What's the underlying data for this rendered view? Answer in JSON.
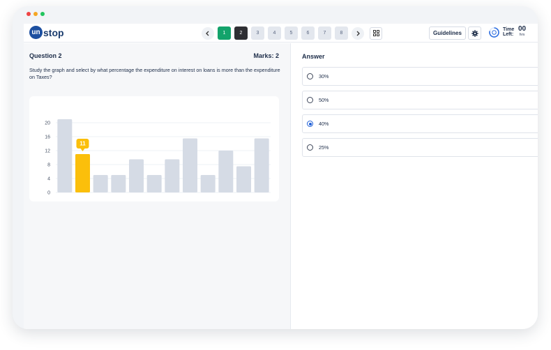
{
  "window": {
    "dot_colors": [
      "#ef4444",
      "#f5a623",
      "#22c55e"
    ]
  },
  "brand": {
    "badge": "un",
    "rest": "stop"
  },
  "nav": {
    "prev_icon": "chevron-left-icon",
    "next_icon": "chevron-right-icon",
    "questions": [
      {
        "label": "1",
        "state": "current"
      },
      {
        "label": "2",
        "state": "visited"
      },
      {
        "label": "3",
        "state": "unvisited"
      },
      {
        "label": "4",
        "state": "unvisited"
      },
      {
        "label": "5",
        "state": "unvisited"
      },
      {
        "label": "6",
        "state": "unvisited"
      },
      {
        "label": "7",
        "state": "unvisited"
      },
      {
        "label": "8",
        "state": "unvisited"
      }
    ],
    "grid_icon": "grid-icon"
  },
  "header": {
    "guidelines_label": "Guidelines",
    "settings_icon": "gear-icon",
    "time_label_1": "Time",
    "time_label_2": "Left:",
    "time_value": "00",
    "time_unit": "hrs"
  },
  "question": {
    "title": "Question 2",
    "marks": "Marks: 2",
    "text": "Study the graph and select by what percentage the expenditure on interest on loans is more than the expenditure on Taxes?"
  },
  "chart_data": {
    "type": "bar",
    "categories": [
      "",
      "",
      "",
      "",
      "",
      "",
      "",
      "",
      "",
      "",
      "",
      ""
    ],
    "values": [
      21,
      11,
      5,
      5,
      9.5,
      5,
      9.5,
      15.5,
      5,
      12,
      7.5,
      15.5
    ],
    "highlight_index": 1,
    "highlight_label": "11",
    "yticks": [
      "0",
      "4",
      "8",
      "12",
      "16",
      "20"
    ],
    "ylim": [
      0,
      22
    ],
    "grid": true,
    "colors": {
      "bar": "#d5dbe5",
      "highlight": "#fbbf0b"
    }
  },
  "answer": {
    "heading": "Answer",
    "selected": 2,
    "options": [
      "30%",
      "50%",
      "40%",
      "25%"
    ]
  }
}
